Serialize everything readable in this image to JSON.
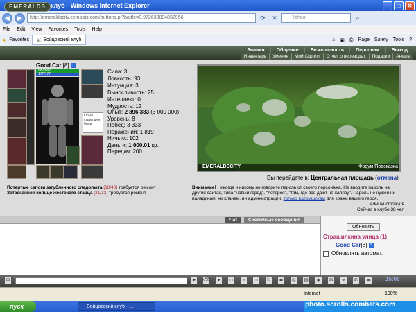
{
  "window": {
    "title": "Бойцовский клуб - Windows Internet Explorer"
  },
  "address": {
    "url": "http://emeraldscity.combats.com/buttons.pl?battle=0.972633894832956",
    "search_placeholder": "Yahoo"
  },
  "menu": [
    "File",
    "Edit",
    "View",
    "Favorites",
    "Tools",
    "Help"
  ],
  "tabs": {
    "favorites": "Favorites",
    "active_tab": "Бойцовский клуб"
  },
  "toolbar": {
    "page": "Page",
    "safety": "Safety",
    "tools": "Tools"
  },
  "game": {
    "logo": "EMERALDS",
    "top_nav": [
      "Знания",
      "Общение",
      "Безопасность",
      "Персонаж",
      "Выход"
    ],
    "sub_nav": [
      "Инвентарь",
      "Умения",
      "Мой Скролл",
      "Отчет о переводах",
      "Подарки",
      "Анкета"
    ]
  },
  "player": {
    "name": "Good Car",
    "level": "[8]",
    "hp": "882/882",
    "mp": "177/177",
    "stats": [
      "Сила: 3",
      "Ловкость: 93",
      "Интуиция: 3",
      "Выносливость: 25",
      "Интеллект: 0",
      "Мудрость: 12"
    ],
    "experience_label": "Опыт:",
    "experience_value": "2 896 383",
    "experience_next": "(3 000 000)",
    "level_line": "Уровень: 8",
    "wins": "Побед: 3 333",
    "losses": "Поражений: 1 819",
    "draws": "Ничьих: 102",
    "money_label": "Деньги:",
    "money_value": "1 000.01",
    "money_unit": "кр.",
    "transfers": "Передач: 200",
    "hint_text": "Обыч стрел для боль"
  },
  "repairs": [
    {
      "item": "Потертые сапоги загубленного следопыта",
      "dmg": "[38/40]",
      "note": "требуется ремонт"
    },
    {
      "item": "Затасканное кольцо жестокого старца",
      "dmg": "[31/33]",
      "note": "требуется ремонт"
    }
  ],
  "map": {
    "caption": "EMERALDSCITY",
    "links": "Форум   Подсказка",
    "goto_prefix": "Вы перейдете в:",
    "goto_place": "Центральная площадь",
    "cancel": "отмена"
  },
  "warning": {
    "head": "Внимание!",
    "text": "Никогда и никому не говорите пароль от своего персонажа. Не вводите пароль на других сайтах, типа \"новый город\", \"лотерея\", \"там, где все дают на халяву\". Пароль не нужен ни паладинам, ни кланам, ни администрации,",
    "link": "только взломщикам",
    "tail": "для кражи вашего героя.",
    "sign": "Администрация",
    "last": "Сейчас в клубе 38 чел"
  },
  "chat": {
    "tab_chat": "Чат",
    "tab_system": "Системные сообщения",
    "refresh": "Обновить",
    "street": "Страшилкина улица (1)",
    "user": "Good Car",
    "user_level": "[8]",
    "auto_refresh": "Обновлять автомат."
  },
  "gamebar": {
    "time": "15:06"
  },
  "status": {
    "zone": "Internet",
    "zoom": "100%"
  },
  "taskbar": {
    "start": "пуск",
    "item": "Бойцовский клуб - ..."
  },
  "watermark": "photo.scrolls.combats.com"
}
